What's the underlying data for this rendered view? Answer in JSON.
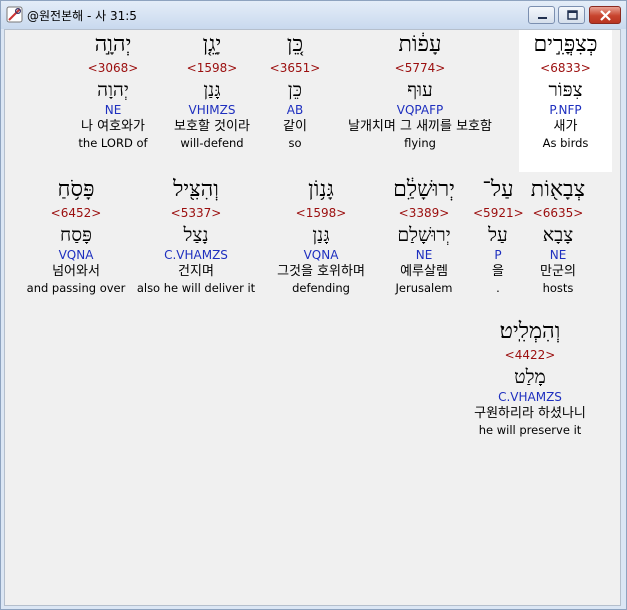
{
  "window": {
    "title": "@원전본해 - 사 31:5"
  },
  "rows": [
    [
      {
        "hebrew": "יְהוָ֣ה",
        "strong": "<3068>",
        "lemma": "יְהוָה",
        "parse": "NE",
        "korean": "나 여호와가",
        "english": "the LORD of"
      },
      {
        "hebrew": "יָגֵ֤ן",
        "strong": "<1598>",
        "lemma": "גָּנַן",
        "parse": "VHIMZS",
        "korean": "보호할 것이라",
        "english": "will-defend"
      },
      {
        "hebrew": "כֵּ֚ן",
        "strong": "<3651>",
        "lemma": "כֵּן",
        "parse": "AB",
        "korean": "같이",
        "english": "so"
      },
      {
        "hebrew": "עָפ֔וֹת",
        "strong": "<5774>",
        "lemma": "עוּף",
        "parse": "VQPAFP",
        "korean": "날개치며 그 새끼를 보호함",
        "english": "flying"
      },
      {
        "hebrew": "כְּצִפֳּרִ֣ים",
        "strong": "<6833>",
        "lemma": "צִפּוֹר",
        "parse": "P.NFP",
        "korean": "새가",
        "english": "As birds",
        "highlighted": true
      }
    ],
    [
      {
        "hebrew": "פָּסֹ֥חַ",
        "strong": "<6452>",
        "lemma": "פָּסַח",
        "parse": "VQNA",
        "korean": "넘어와서",
        "english": "and passing over"
      },
      {
        "hebrew": "וְהִצִּ֖יל",
        "strong": "<5337>",
        "lemma": "נָצַל",
        "parse": "C.VHAMZS",
        "korean": "건지며",
        "english": "also he will deliver it"
      },
      {
        "hebrew": "גָּנ֥וֹן",
        "strong": "<1598>",
        "lemma": "גָּנַן",
        "parse": "VQNA",
        "korean": "그것을 호위하며",
        "english": "defending"
      },
      {
        "hebrew": "יְרוּשָׁלִַ֔ם",
        "strong": "<3389>",
        "lemma": "יְרוּשָׁלַם",
        "parse": "NE",
        "korean": "예루살렘",
        "english": "Jerusalem"
      },
      {
        "hebrew": "עַל־",
        "strong": "<5921>",
        "lemma": "עַל",
        "parse": "P",
        "korean": "을",
        "english": "."
      },
      {
        "hebrew": "צְבָא֖וֹת",
        "strong": "<6635>",
        "lemma": "צָבָא",
        "parse": "NE",
        "korean": "만군의",
        "english": "hosts"
      }
    ],
    [
      {
        "hebrew": "וְהִמְלִֽיט׃",
        "strong": "<4422>",
        "lemma": "מָלַט",
        "parse": "C.VHAMZS",
        "korean": "구원하리라 하셨나니",
        "english": "he will preserve it"
      }
    ]
  ]
}
